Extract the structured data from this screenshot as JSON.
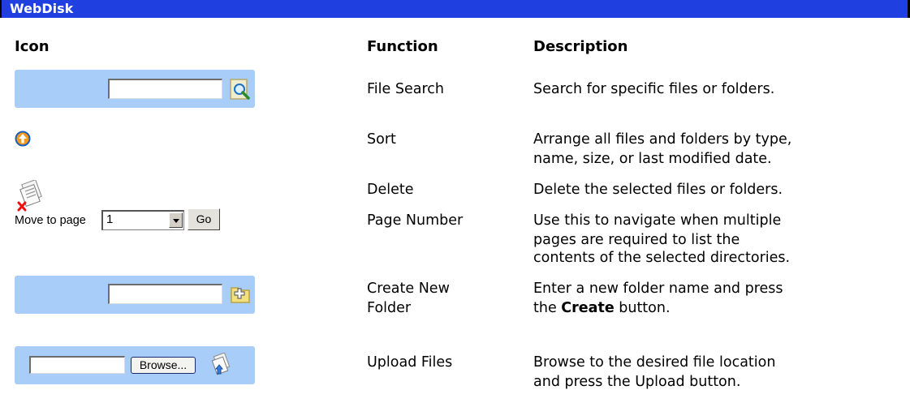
{
  "section_title": "WebDisk",
  "headers": {
    "icon": "Icon",
    "function": "Function",
    "description": "Description"
  },
  "rows": [
    {
      "icon": "file-search-icon",
      "function": "File Search",
      "description": [
        "Search for specific files or folders."
      ]
    },
    {
      "icon": "sort-up-arrow-icon",
      "function": "Sort",
      "description": [
        "Arrange all files and folders by type,",
        "name, size, or last modified date."
      ]
    },
    {
      "icon": "delete-files-icon",
      "function": "Delete",
      "description": [
        "Delete the selected files or folders."
      ]
    },
    {
      "icon": "page-number-control",
      "function": "Page Number",
      "description": [
        "Use this to navigate when multiple",
        "pages are required to list the",
        "contents of the selected directories."
      ]
    },
    {
      "icon": "new-folder-icon",
      "function": [
        "Create New",
        "Folder"
      ],
      "description": {
        "before": "Enter a new folder name and press",
        "pre": "the ",
        "bold": "Create",
        "post": " button."
      }
    },
    {
      "icon": "upload-files-icon",
      "function": "Upload Files",
      "description": [
        "Browse to the desired file location",
        "and press the Upload button."
      ]
    }
  ],
  "page_control": {
    "label": "Move to page",
    "selected": "1",
    "go_label": "Go"
  },
  "upload_control": {
    "browse_label": "Browse..."
  },
  "colors": {
    "title_bar": "#1f3fe0",
    "icon_bar": "#a8cdf8"
  }
}
